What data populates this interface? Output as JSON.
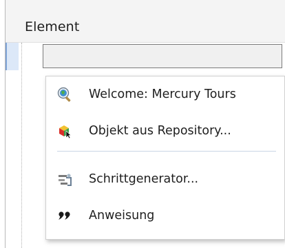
{
  "column_header": {
    "label": "Element"
  },
  "cell_input": {
    "value": ""
  },
  "menu": {
    "items": [
      {
        "label": "Welcome: Mercury Tours",
        "icon": "browser-object-icon"
      },
      {
        "label": "Objekt aus Repository...",
        "icon": "object-repository-icon"
      },
      {
        "label": "Schrittgenerator...",
        "icon": "step-generator-icon"
      },
      {
        "label": "Anweisung",
        "icon": "comment-statement-icon"
      }
    ]
  }
}
